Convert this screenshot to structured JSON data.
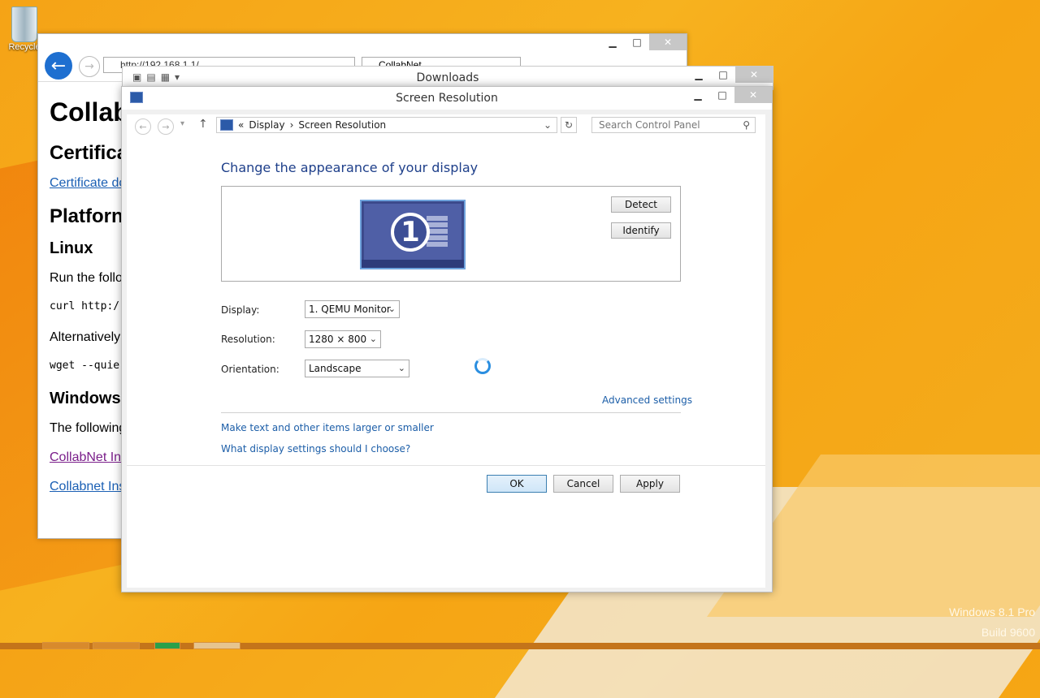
{
  "desktop": {
    "recycle_label": "Recycle",
    "watermark_line1": "Windows 8.1 Pro",
    "watermark_line2": "Build 9600"
  },
  "ie": {
    "address": "http://192.168.1.1/",
    "tab": "CollabNet",
    "content": {
      "h1": "Collab",
      "certificate_heading": "Certifica",
      "certificate_link": "Certificate do",
      "platform_heading": "Platforn",
      "linux_heading": "Linux",
      "run_text": "Run the follo",
      "curl_code": "curl http:/",
      "alternatively_text": "Alternatively",
      "wget_code": "wget --quie",
      "windows_heading": "Windows",
      "following_text": "The following",
      "collabnet_link1": "CollabNet In",
      "collabnet_link2": "Collabnet Ins"
    }
  },
  "downloads": {
    "title": "Downloads"
  },
  "screen_resolution": {
    "title": "Screen Resolution",
    "breadcrumb": [
      "«",
      "Display",
      "›",
      "Screen Resolution"
    ],
    "search_placeholder": "Search Control Panel",
    "heading": "Change the appearance of your display",
    "monitor_number": "1",
    "detect_label": "Detect",
    "identify_label": "Identify",
    "display_label": "Display:",
    "display_value": "1. QEMU Monitor",
    "resolution_label": "Resolution:",
    "resolution_value": "1280 × 800",
    "orientation_label": "Orientation:",
    "orientation_value": "Landscape",
    "advanced_link": "Advanced settings",
    "text_size_link": "Make text and other items larger or smaller",
    "help_link": "What display settings should I choose?",
    "ok_label": "OK",
    "cancel_label": "Cancel",
    "apply_label": "Apply"
  }
}
